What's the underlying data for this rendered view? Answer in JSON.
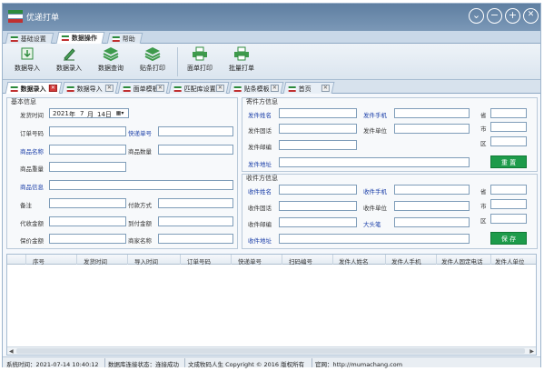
{
  "app": {
    "title": "优递打单"
  },
  "window_controls": {
    "options": "⌄",
    "minimize": "−",
    "maximize": "+",
    "close": "✕"
  },
  "menu_tabs": [
    {
      "label": "基础设置",
      "active": false
    },
    {
      "label": "数据操作",
      "active": true
    },
    {
      "label": "帮助",
      "active": false
    }
  ],
  "toolbar": [
    {
      "label": "数据导入",
      "icon": "import-icon"
    },
    {
      "label": "数据录入",
      "icon": "pen-icon"
    },
    {
      "label": "数据查询",
      "icon": "layers-icon"
    },
    {
      "label": "贴条打印",
      "icon": "layers-print-icon"
    },
    {
      "label": "面单打印",
      "icon": "print-icon"
    },
    {
      "label": "批量打单",
      "icon": "batch-print-icon"
    }
  ],
  "doc_tabs": [
    {
      "label": "数据录入",
      "active": true
    },
    {
      "label": "数据导入",
      "active": false
    },
    {
      "label": "面单模板",
      "active": false
    },
    {
      "label": "匹配库设置",
      "active": false
    },
    {
      "label": "贴条模板",
      "active": false
    },
    {
      "label": "首页",
      "active": false
    }
  ],
  "basic_info": {
    "title": "基本信息",
    "send_time_label": "发货时间",
    "date": {
      "year": "2021",
      "year_unit": "年",
      "month": "7",
      "month_unit": "月",
      "day": "14日"
    },
    "order_no": "订单号码",
    "express_no": "快递单号",
    "goods_name": "商品名称",
    "goods_qty": "商品数量",
    "goods_weight": "商品重量",
    "goods_info": "商品信息",
    "remark": "备注",
    "pay_method": "付款方式",
    "cod_amount": "代收金额",
    "arrival_pay": "到付金额",
    "insured_amount": "保价金额",
    "shop_name": "商家名称"
  },
  "sender_info": {
    "title": "寄件方信息",
    "name": "发件姓名",
    "mobile": "发件手机",
    "phone": "发件固话",
    "company": "发件单位",
    "postcode": "发件邮编",
    "address": "发件地址",
    "province": "省",
    "city": "市",
    "district": "区",
    "reset_button": "重 置"
  },
  "receiver_info": {
    "title": "收件方信息",
    "name": "收件姓名",
    "mobile": "收件手机",
    "phone": "收件固话",
    "company": "收件单位",
    "postcode": "收件邮编",
    "big_pen": "大头笔",
    "address": "收件地址",
    "province": "省",
    "city": "市",
    "district": "区",
    "save_button": "保 存"
  },
  "grid": {
    "columns": [
      "序号",
      "发货时间",
      "导入时间",
      "订单号码",
      "快递单号",
      "扫码编号",
      "发件人姓名",
      "发件人手机",
      "发件人固定电话",
      "发件人单位"
    ],
    "rows": []
  },
  "statusbar": {
    "time": "系统时间：2021-07-14 10:40:12",
    "db": "数据库连接状态：连接成功",
    "copyright": "文成牧码人生 Copyright © 2016 版权所有",
    "website": "官网：http://mumachang.com"
  },
  "colors": {
    "titlebar": "#6d8bab",
    "accent_green": "#1d9b4a",
    "label_blue": "#1a3ea8",
    "close_red": "#d23a3a"
  }
}
